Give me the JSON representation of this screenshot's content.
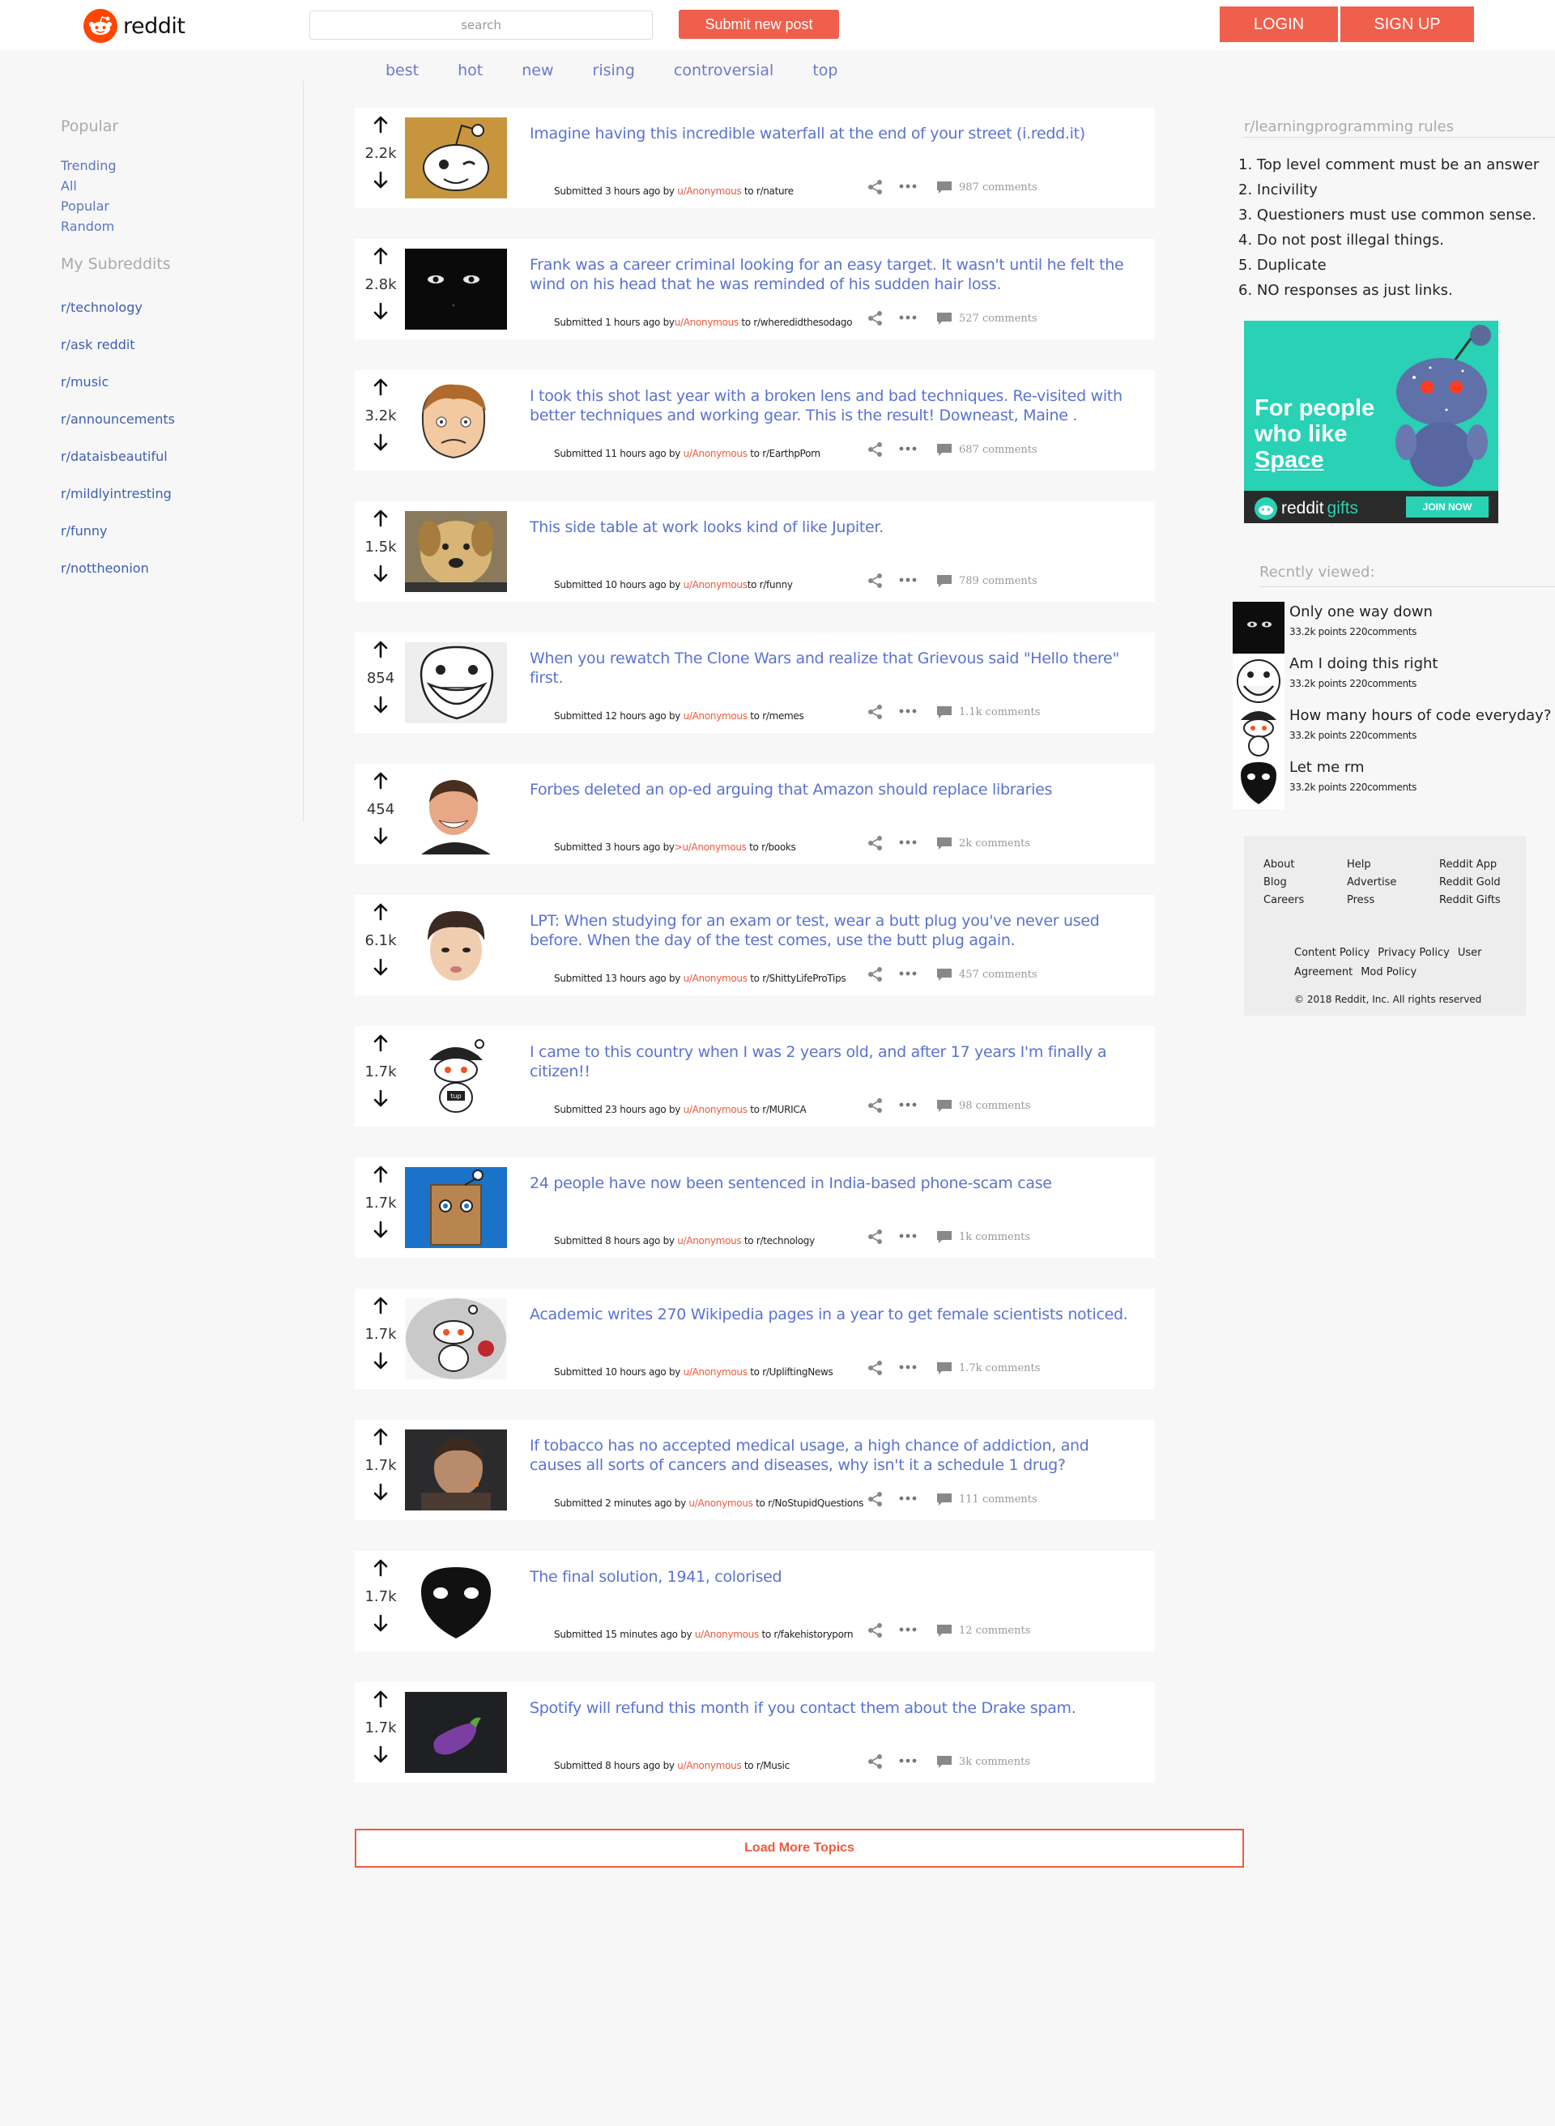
{
  "header": {
    "logo_text": "reddit",
    "search_placeholder": "search",
    "submit_label": "Submit new post",
    "login_label": "LOGIN",
    "signup_label": "SIGN UP",
    "accent_color": "#f05f4b"
  },
  "tabs": [
    "best",
    "hot",
    "new",
    "rising",
    "controversial",
    "top"
  ],
  "leftbar": {
    "popular_heading": "Popular",
    "links": [
      "Trending",
      "All",
      "Popular",
      "Random"
    ],
    "mysubs_heading": "My Subreddits",
    "subs": [
      "r/technology",
      "r/ask reddit",
      "r/music",
      "r/announcements",
      "r/dataisbeautiful",
      "r/mildlyintresting",
      "r/funny",
      "r/nottheonion"
    ]
  },
  "posts": [
    {
      "score": "2.2k",
      "title": "Imagine having this incredible waterfall at the end of your street (i.redd.it)",
      "submitted": "Submitted 3 hours ago by ",
      "user": "u/Anonymous",
      "to": " to ",
      "sub": "r/nature",
      "comments": "987 comments",
      "thumb": "snoo-wink-icon"
    },
    {
      "score": "2.8k",
      "title": "Frank was a career criminal looking for an easy target. It wasn't until he felt the wind on his head that he was reminded of his sudden hair loss.",
      "submitted": "Submitted 1 hours ago by",
      "user": "u/Anonymous",
      "to": " to ",
      "sub": "r/wheredidthesodago",
      "comments": "527 comments",
      "thumb": "dark-face-icon"
    },
    {
      "score": "3.2k",
      "title": "I took this shot last year with a broken lens and bad techniques. Re-visited with better techniques and working gear. This is the result! Downeast, Maine .",
      "submitted": "Submitted 11 hours ago by ",
      "user": "u/Anonymous",
      "to": " to ",
      "sub": "r/EarthpPorn",
      "comments": "687 comments",
      "thumb": "rage-face-icon"
    },
    {
      "score": "1.5k",
      "title": "This side table at work looks kind of like Jupiter.",
      "submitted": "Submitted 10 hours ago by ",
      "user": "u/Anonymous",
      "to": "to ",
      "sub": "r/funny",
      "comments": "789 comments",
      "thumb": "dog-photo-icon"
    },
    {
      "score": "854",
      "title": "When you rewatch The Clone Wars and realize that Grievous said \"Hello there\" first.",
      "submitted": "Submitted 12 hours ago by ",
      "user": "u/Anonymous",
      "to": " to ",
      "sub": "r/memes",
      "comments": "1.1k comments",
      "thumb": "troll-face-icon"
    },
    {
      "score": "454",
      "title": "Forbes deleted an op-ed arguing that Amazon should replace libraries",
      "submitted": "Submitted 3 hours ago by",
      "user": ">u/Anonymous",
      "to": " to ",
      "sub": "r/books",
      "comments": "2k comments",
      "thumb": "laughing-man-icon"
    },
    {
      "score": "6.1k",
      "title": "LPT: When studying for an exam or test, wear a butt plug you've never used before. When the day of the test comes, use the butt plug again.",
      "submitted": "Submitted 13 hours ago by ",
      "user": "u/Anonymous",
      "to": " to ",
      "sub": "r/ShittyLifeProTips",
      "comments": "457 comments",
      "thumb": "boy-face-icon"
    },
    {
      "score": "1.7k",
      "title": "I came to this country when I was 2 years old, and after 17 years I'm finally a citizen!!",
      "submitted": "Submitted 23 hours ago by ",
      "user": "u/Anonymous",
      "to": " to ",
      "sub": "r/MURICA",
      "comments": "98 comments",
      "thumb": "snoo-hat-icon"
    },
    {
      "score": "1.7k",
      "title": "24 people have now been sentenced in India-based phone-scam case",
      "submitted": "Submitted 8 hours ago by ",
      "user": "u/Anonymous",
      "to": " to ",
      "sub": "r/technology",
      "comments": "1k comments",
      "thumb": "snoo-bag-icon"
    },
    {
      "score": "1.7k",
      "title": "Academic writes 270 Wikipedia pages in a year to get female scientists noticed.",
      "submitted": "Submitted 10 hours ago by ",
      "user": "u/Anonymous",
      "to": " to ",
      "sub": "r/UpliftingNews",
      "comments": "1.7k comments",
      "thumb": "snoo-rose-icon"
    },
    {
      "score": "1.7k",
      "title": "If tobacco has no accepted medical usage, a high chance of addiction, and causes all sorts of cancers and diseases, why isn't it a schedule 1 drug?",
      "submitted": "Submitted 2 minutes ago by ",
      "user": "u/Anonymous",
      "to": " to ",
      "sub": "r/NoStupidQuestions",
      "comments": "111 comments",
      "thumb": "man-smoking-icon"
    },
    {
      "score": "1.7k",
      "title": "The final solution, 1941, colorised",
      "submitted": "Submitted 15 minutes ago by ",
      "user": "u/Anonymous",
      "to": " to ",
      "sub": "r/fakehistoryporn",
      "comments": "12 comments",
      "thumb": "black-head-icon"
    },
    {
      "score": "1.7k",
      "title": "Spotify will refund this month if you contact them about the Drake spam.",
      "submitted": "Submitted 8 hours ago by ",
      "user": "u/Anonymous",
      "to": " to ",
      "sub": "r/Music",
      "comments": "3k comments",
      "thumb": "eggplant-icon"
    }
  ],
  "load_more": "Load More Topics",
  "rightbar": {
    "rules_title": "r/learningprogramming rules",
    "rules": [
      "1. Top level comment must be an answer",
      "2. Incivility",
      "3. Questioners must use common sense.",
      "4. Do not post illegal things.",
      "5. Duplicate",
      "6. NO responses as just links."
    ],
    "ad": {
      "line1": "For people",
      "line2": "who like",
      "line3": "Space",
      "brand": "reddit",
      "brand2": "gifts",
      "cta": "JOIN NOW"
    },
    "recent_title": "Recntly viewed:",
    "recent": [
      {
        "title": "Only one way down",
        "meta": "33.2k points 220comments"
      },
      {
        "title": "Am I doing this right",
        "meta": "33.2k points 220comments"
      },
      {
        "title": "How many hours of code everyday?",
        "meta": "33.2k points 220comments"
      },
      {
        "title": "Let me rm",
        "meta": "33.2k points 220comments"
      }
    ]
  },
  "footer": {
    "col1": [
      "About",
      "Blog",
      "Careers"
    ],
    "col2": [
      "Help",
      "Advertise",
      "Press"
    ],
    "col3": [
      "Reddit App",
      "Reddit Gold",
      "Reddit Gifts"
    ],
    "legal": [
      "Content Policy",
      "Privacy Policy",
      "User Agreement",
      "Mod Policy"
    ],
    "copyright": "© 2018 Reddit, Inc. All rights reserved"
  }
}
